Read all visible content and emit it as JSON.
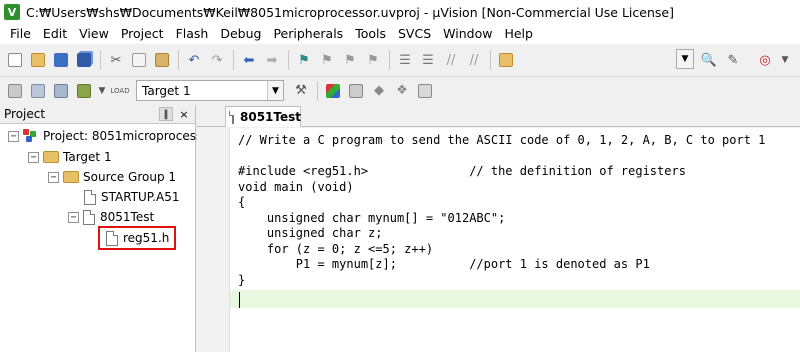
{
  "window": {
    "title": "C:₩Users₩shs₩Documents₩Keil₩8051microprocessor.uvproj - µVision  [Non-Commercial Use License]",
    "app_icon": "V"
  },
  "menu": [
    "File",
    "Edit",
    "View",
    "Project",
    "Flash",
    "Debug",
    "Peripherals",
    "Tools",
    "SVCS",
    "Window",
    "Help"
  ],
  "toolbar2": {
    "target": "Target 1"
  },
  "project_panel": {
    "title": "Project",
    "pin": "‖",
    "close": "×",
    "tree": {
      "project": "Project: 8051microprocessc",
      "target": "Target 1",
      "group": "Source Group 1",
      "startup": "STARTUP.A51",
      "file": "8051Test",
      "header": "reg51.h"
    }
  },
  "editor": {
    "tab": "8051Test",
    "lines": [
      "// Write a C program to send the ASCII code of 0, 1, 2, A, B, C to port 1",
      "",
      "#include <reg51.h>              // the definition of registers",
      "void main (void)",
      "{",
      "    unsigned char mynum[] = \"012ABC\";",
      "    unsigned char z;",
      "    for (z = 0; z <=5; z++)",
      "        P1 = mynum[z];          //port 1 is denoted as P1",
      "}",
      ""
    ]
  },
  "colors": {
    "current_line": "#e8f8e0",
    "highlight_box": "#e01010"
  }
}
